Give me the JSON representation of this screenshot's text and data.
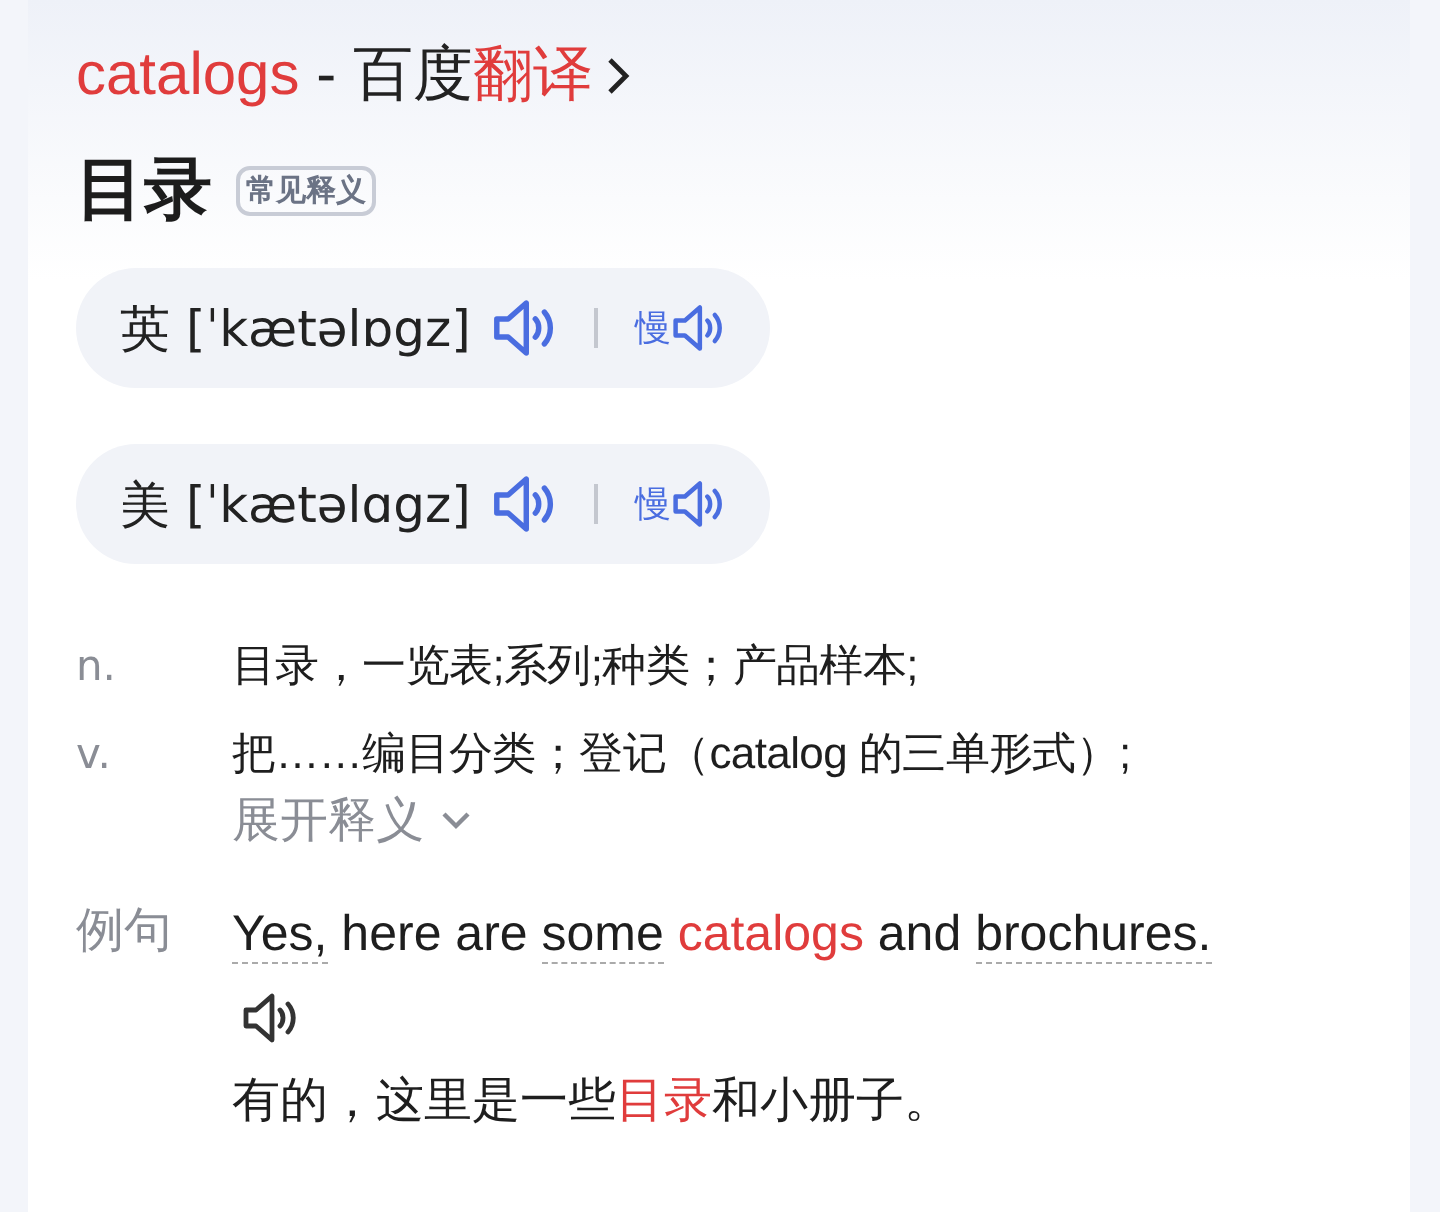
{
  "title": {
    "segments": [
      {
        "text": "catalogs",
        "highlight": true
      },
      {
        "text": " - 百度",
        "highlight": false
      },
      {
        "text": "翻译",
        "highlight": true
      }
    ]
  },
  "headword": "目录",
  "headword_tag": "常见释义",
  "pronunciations": [
    {
      "region": "英",
      "phonetic": "[ˈkætəlɒgz]",
      "slow_label": "慢"
    },
    {
      "region": "美",
      "phonetic": "[ˈkætəlɑgz]",
      "slow_label": "慢"
    }
  ],
  "definitions": [
    {
      "pos": "n.",
      "meaning": "目录，一览表;系列;种类；产品样本;"
    },
    {
      "pos": "v.",
      "meaning": "把……编目分类；登记（catalog 的三单形式）;"
    }
  ],
  "expand_label": "展开释义",
  "example": {
    "label": "例句",
    "sentence": [
      {
        "text": "Yes,",
        "highlight": false,
        "underlined": true
      },
      {
        "text": " here are ",
        "highlight": false,
        "underlined": false
      },
      {
        "text": "some",
        "highlight": false,
        "underlined": true
      },
      {
        "text": " catalogs",
        "highlight": true,
        "underlined": false
      },
      {
        "text": " and ",
        "highlight": false,
        "underlined": false
      },
      {
        "text": "brochures.",
        "highlight": false,
        "underlined": true
      }
    ],
    "translation": [
      {
        "text": "有的，这里是一些",
        "highlight": false
      },
      {
        "text": "目录",
        "highlight": true
      },
      {
        "text": "和小册子。",
        "highlight": false
      }
    ]
  }
}
